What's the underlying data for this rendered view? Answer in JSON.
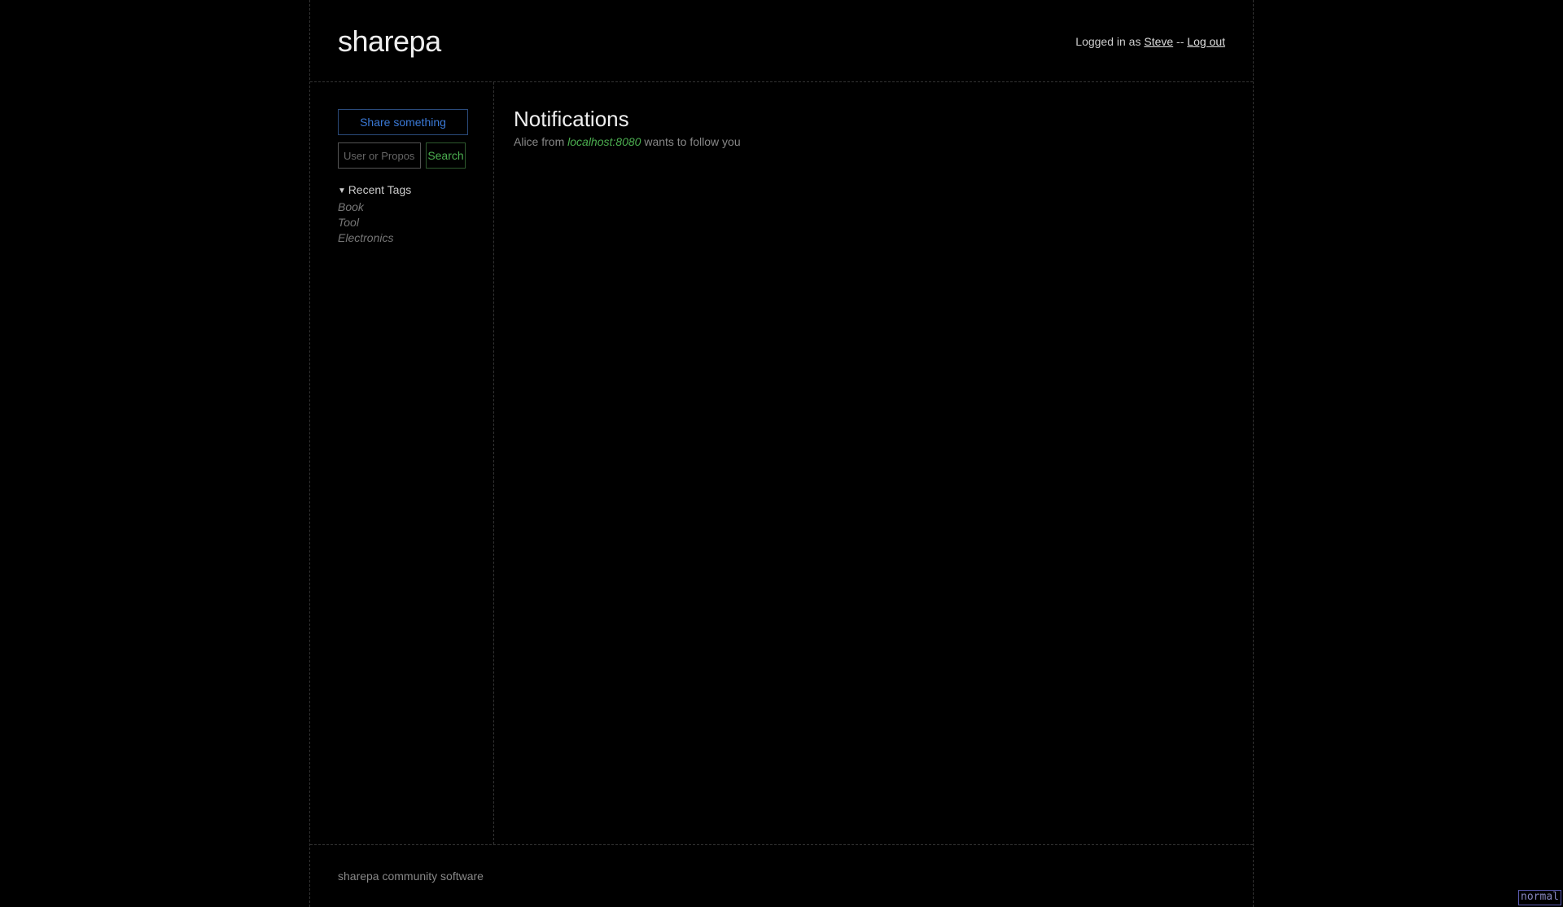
{
  "header": {
    "logo": "sharepa",
    "logged_in_prefix": "Logged in as ",
    "username": "Steve",
    "separator": " -- ",
    "logout_label": "Log out"
  },
  "sidebar": {
    "share_label": "Share something",
    "search_placeholder": "User or Proposal",
    "search_button": "Search",
    "tags_header": "Recent Tags",
    "tags": [
      "Book",
      "Tool",
      "Electronics"
    ]
  },
  "main": {
    "title": "Notifications",
    "notifications": [
      {
        "user": "Alice",
        "from_word": " from ",
        "host": "localhost:8080",
        "tail": " wants to follow you"
      }
    ]
  },
  "footer": {
    "text": "sharepa community software"
  },
  "badge": {
    "mode": "normal"
  }
}
